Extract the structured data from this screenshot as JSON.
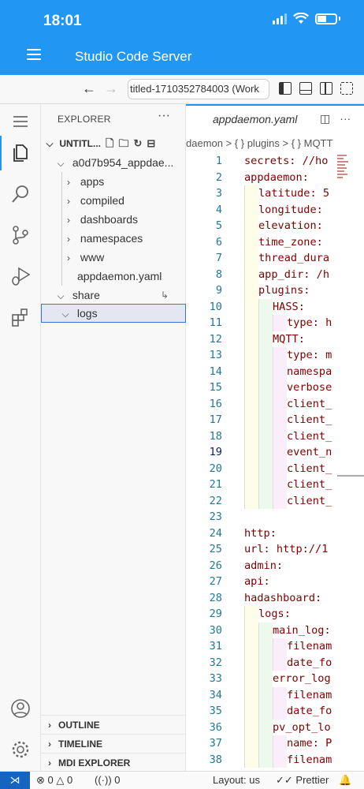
{
  "status": {
    "time": "18:01"
  },
  "header": {
    "title": "Studio Code Server"
  },
  "titlebar": {
    "command_center": "titled-1710352784003 (Work"
  },
  "explorer": {
    "title": "EXPLORER",
    "workspace": "UNTITL...",
    "folder": "a0d7b954_appdae...",
    "items": [
      "apps",
      "compiled",
      "dashboards",
      "namespaces",
      "www",
      "appdaemon.yaml",
      "share",
      "logs"
    ]
  },
  "sections": [
    "OUTLINE",
    "TIMELINE",
    "MDI EXPLORER"
  ],
  "editor": {
    "tab": "appdaemon.yaml",
    "breadcrumb": "daemon > { } plugins > { } MQTT",
    "lines": [
      {
        "n": "1",
        "t": "secrets: //ho"
      },
      {
        "n": "2",
        "t": "appdaemon:"
      },
      {
        "n": "3",
        "t": "latitude: 5"
      },
      {
        "n": "4",
        "t": "longitude:"
      },
      {
        "n": "5",
        "t": "elevation:"
      },
      {
        "n": "6",
        "t": "time_zone:"
      },
      {
        "n": "7",
        "t": "thread_dura"
      },
      {
        "n": "8",
        "t": "app_dir: /h"
      },
      {
        "n": "9",
        "t": "plugins:"
      },
      {
        "n": "10",
        "t": "HASS:"
      },
      {
        "n": "11",
        "t": "type: h"
      },
      {
        "n": "12",
        "t": "MQTT:"
      },
      {
        "n": "13",
        "t": "type: m"
      },
      {
        "n": "14",
        "t": "namespa"
      },
      {
        "n": "15",
        "t": "verbose"
      },
      {
        "n": "16",
        "t": "client_"
      },
      {
        "n": "17",
        "t": "client_"
      },
      {
        "n": "18",
        "t": "client_"
      },
      {
        "n": "19",
        "t": "event_n"
      },
      {
        "n": "20",
        "t": "client_"
      },
      {
        "n": "21",
        "t": "client_"
      },
      {
        "n": "22",
        "t": "client_"
      },
      {
        "n": "23",
        "t": ""
      },
      {
        "n": "24",
        "t": "http:"
      },
      {
        "n": "25",
        "t": "url: http://1"
      },
      {
        "n": "26",
        "t": "admin:"
      },
      {
        "n": "27",
        "t": "api:"
      },
      {
        "n": "28",
        "t": "hadashboard:"
      },
      {
        "n": "29",
        "t": "logs:"
      },
      {
        "n": "30",
        "t": "main_log:"
      },
      {
        "n": "31",
        "t": "filenam"
      },
      {
        "n": "32",
        "t": "date_fo"
      },
      {
        "n": "33",
        "t": "error_log"
      },
      {
        "n": "34",
        "t": "filenam"
      },
      {
        "n": "35",
        "t": "date_fo"
      },
      {
        "n": "36",
        "t": "pv_opt_lo"
      },
      {
        "n": "37",
        "t": "name: P"
      },
      {
        "n": "38",
        "t": "filenam"
      }
    ]
  },
  "statusbar": {
    "errors": "0",
    "warnings": "0",
    "ports": "0",
    "layout": "Layout: us",
    "prettier": "Prettier"
  }
}
